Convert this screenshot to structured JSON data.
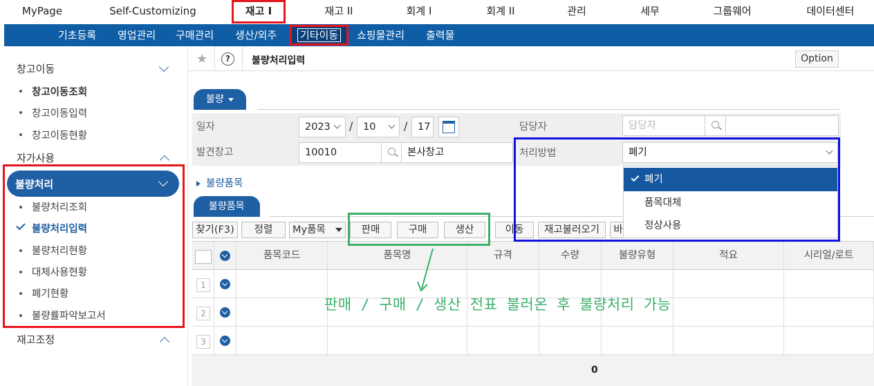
{
  "top_menu": [
    "MyPage",
    "Self-Customizing",
    "재고 I",
    "재고 II",
    "회계 I",
    "회계 II",
    "관리",
    "세무",
    "그룹웨어",
    "데이터센터"
  ],
  "sub_menu": [
    "기초등록",
    "영업관리",
    "구매관리",
    "생산/외주",
    "기타이동",
    "쇼핑몰관리",
    "출력물"
  ],
  "sidebar": {
    "group_warehouse": "창고이동",
    "warehouse_items": [
      "창고이동조회",
      "창고이동입력",
      "창고이동현황"
    ],
    "group_selfuse": "자가사용",
    "group_defect": "불량처리",
    "defect_items": [
      "불량처리조회",
      "불량처리입력",
      "불량처리현황",
      "대체사용현황",
      "폐기현황",
      "불량률파악보고서"
    ],
    "group_adjust": "재고조정"
  },
  "page": {
    "star_icon": "star-icon",
    "help_label": "?",
    "title": "불량처리입력",
    "option_label": "Option"
  },
  "form": {
    "tab_label": "불량",
    "date_label": "일자",
    "year": "2023",
    "month": "10",
    "day": "17",
    "slash": "/",
    "manager_label": "담당자",
    "manager_placeholder": "담당자",
    "warehouse_label": "발견창고",
    "warehouse_code": "10010",
    "warehouse_name": "본사창고",
    "method_label": "처리방법",
    "method_value": "폐기"
  },
  "dropdown": {
    "options": [
      "폐기",
      "품목대체",
      "정상사용"
    ],
    "selected": "폐기"
  },
  "items_section": {
    "expander_label": "불량품목",
    "tab_label": "불량품목",
    "buttons": {
      "find": "찾기(F3)",
      "sort": "정렬",
      "my_items": "My품목",
      "sales": "판매",
      "purchase": "구매",
      "production": "생산",
      "move": "이동",
      "load_stock": "재고불러오기",
      "partial_b": "바"
    },
    "columns": [
      "품목코드",
      "품목명",
      "규격",
      "수량",
      "불량유형",
      "적요",
      "시리얼/로트"
    ],
    "rows": [
      "1",
      "2",
      "3"
    ],
    "total_qty": "0"
  },
  "annotation": "판매 / 구매 / 생산 전표 불러온 후 불량처리 가능",
  "colors": {
    "brand_blue": "#1f5fa3",
    "sub_bar": "#0f5da5",
    "highlight_red": "#e8141b",
    "highlight_blue": "#1010e0",
    "annotation_green": "#3bb06b"
  }
}
